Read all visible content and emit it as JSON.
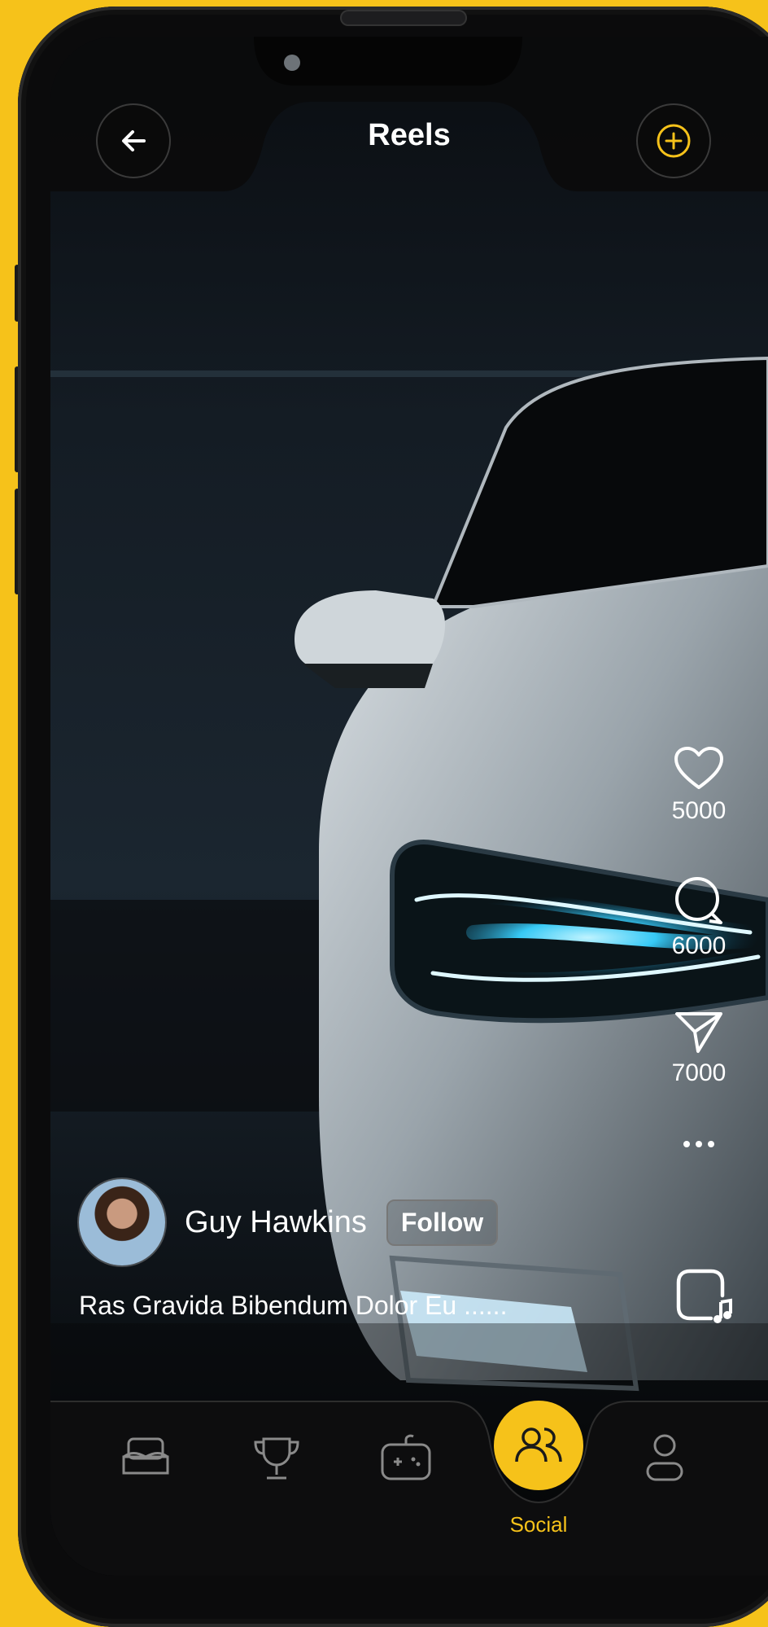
{
  "header": {
    "title": "Reels",
    "back_icon": "arrow-left-icon",
    "add_icon": "plus-circle-icon"
  },
  "reel": {
    "likes": "5000",
    "comments": "6000",
    "shares": "7000",
    "more_icon": "ellipsis-icon",
    "audio_icon": "music-note-icon"
  },
  "user": {
    "name": "Guy Hawkins",
    "follow_label": "Follow",
    "caption": "Ras Gravida Bibendum Dolor Eu ......"
  },
  "nav": {
    "items": [
      {
        "icon": "sofa-icon",
        "label": ""
      },
      {
        "icon": "trophy-icon",
        "label": ""
      },
      {
        "icon": "gamepad-icon",
        "label": ""
      },
      {
        "icon": "users-icon",
        "label": "Social",
        "active": true
      },
      {
        "icon": "profile-icon",
        "label": ""
      }
    ]
  },
  "colors": {
    "accent": "#F6C21A",
    "background": "#0B0B0C",
    "text": "#FFFFFF",
    "headlight": "#37C9F5"
  }
}
